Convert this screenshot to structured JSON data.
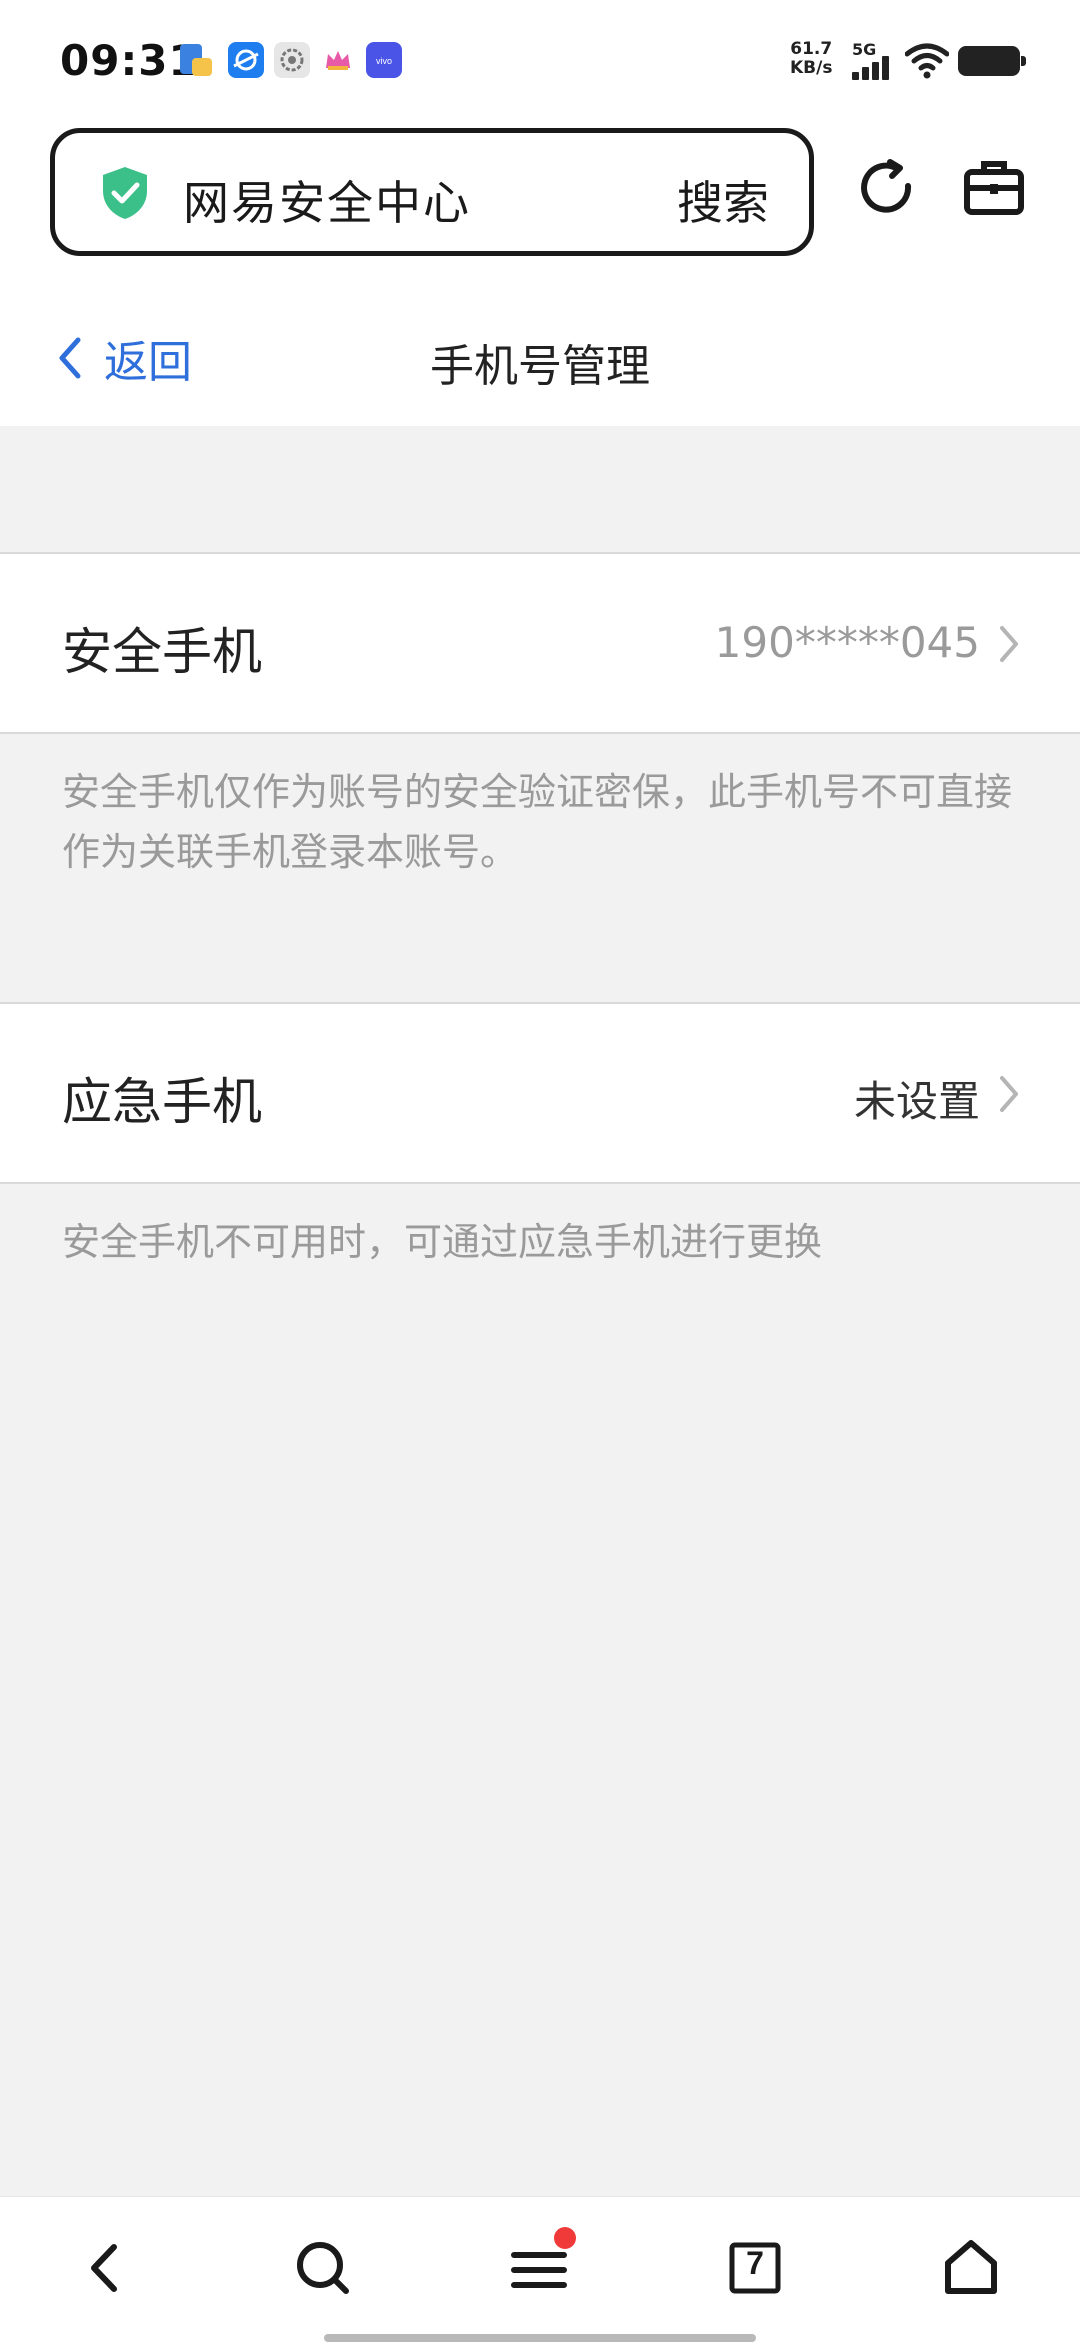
{
  "status_bar": {
    "time": "09:31",
    "net_speed_value": "61.7",
    "net_speed_unit": "KB/s",
    "network": "5G",
    "icons": [
      "files-app-icon",
      "browser-app-icon",
      "settings-app-icon",
      "crown-app-icon",
      "vivo-app-icon",
      "signal-icon",
      "wifi-icon",
      "battery-icon"
    ]
  },
  "browser": {
    "address_text": "网易安全中心",
    "search_label": "搜索",
    "shield_color": "#3cc08a",
    "icons": [
      "shield-check-icon",
      "refresh-icon",
      "toolbox-icon"
    ]
  },
  "header": {
    "back_label": "返回",
    "title": "手机号管理",
    "accent_color": "#2f6fdb"
  },
  "security_phone": {
    "label": "安全手机",
    "value": "190*****045",
    "note": "安全手机仅作为账号的安全验证密保，此手机号不可直接作为关联手机登录本账号。"
  },
  "emergency_phone": {
    "label": "应急手机",
    "value": "未设置",
    "note": "安全手机不可用时，可通过应急手机进行更换"
  },
  "bottom_nav": {
    "tab_count": "7",
    "icons": [
      "back-arrow-icon",
      "search-icon",
      "menu-icon",
      "tabs-icon",
      "home-icon"
    ],
    "badge_color": "#f03a3a"
  }
}
